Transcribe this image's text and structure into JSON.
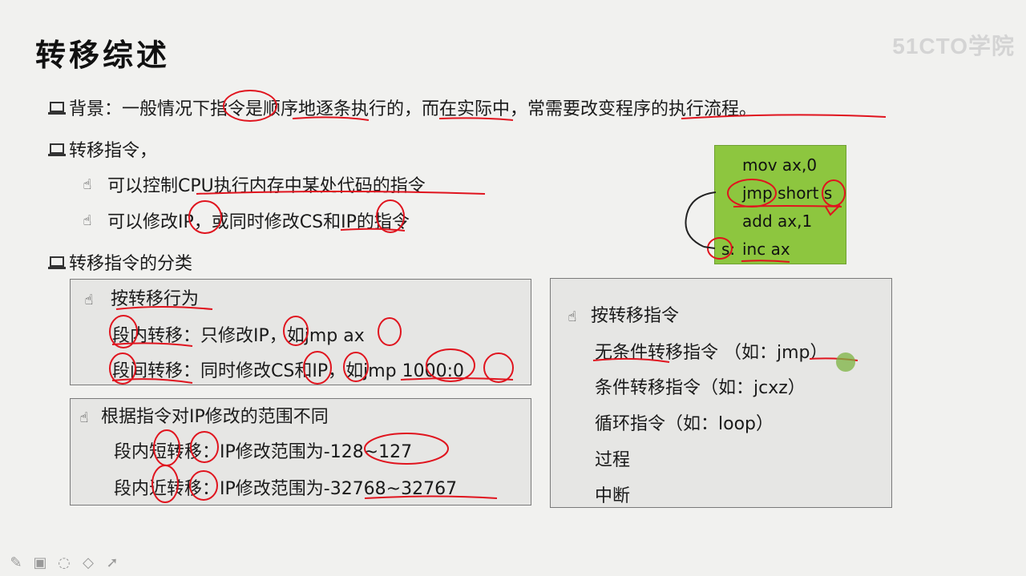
{
  "title": "转移综述",
  "watermark": "51CTO学院",
  "bullets": {
    "background": "背景：一般情况下指令是顺序地逐条执行的，而在实际中，常需要改变程序的执行流程。",
    "transfer": "转移指令，",
    "transfer_sub": [
      "可以控制CPU执行内存中某处代码的指令",
      "可以修改IP，或同时修改CS和IP的指令"
    ],
    "classify": "转移指令的分类"
  },
  "box_behavior": {
    "heading": "按转移行为",
    "items": [
      "段内转移：只修改IP，如jmp ax",
      "段间转移：同时修改CS和IP，如jmp 1000:0"
    ]
  },
  "box_range": {
    "heading": "根据指令对IP修改的范围不同",
    "items": [
      "段内短转移：IP修改范围为-128~127",
      "段内近转移：IP修改范围为-32768~32767"
    ]
  },
  "box_instr": {
    "heading": "按转移指令",
    "items": [
      "无条件转移指令 （如：jmp）",
      "条件转移指令（如：jcxz）",
      "循环指令（如：loop）",
      "过程",
      "中断"
    ]
  },
  "code": {
    "lines": [
      "mov ax,0",
      "jmp short s",
      "add ax,1",
      "inc ax"
    ],
    "label": "s:"
  },
  "colors": {
    "code_bg": "#8dc63f",
    "ink": "#e0141e"
  },
  "toolbar_icons": [
    "pen-icon",
    "screen-icon",
    "highlighter-icon",
    "eraser-icon",
    "pointer-icon"
  ]
}
